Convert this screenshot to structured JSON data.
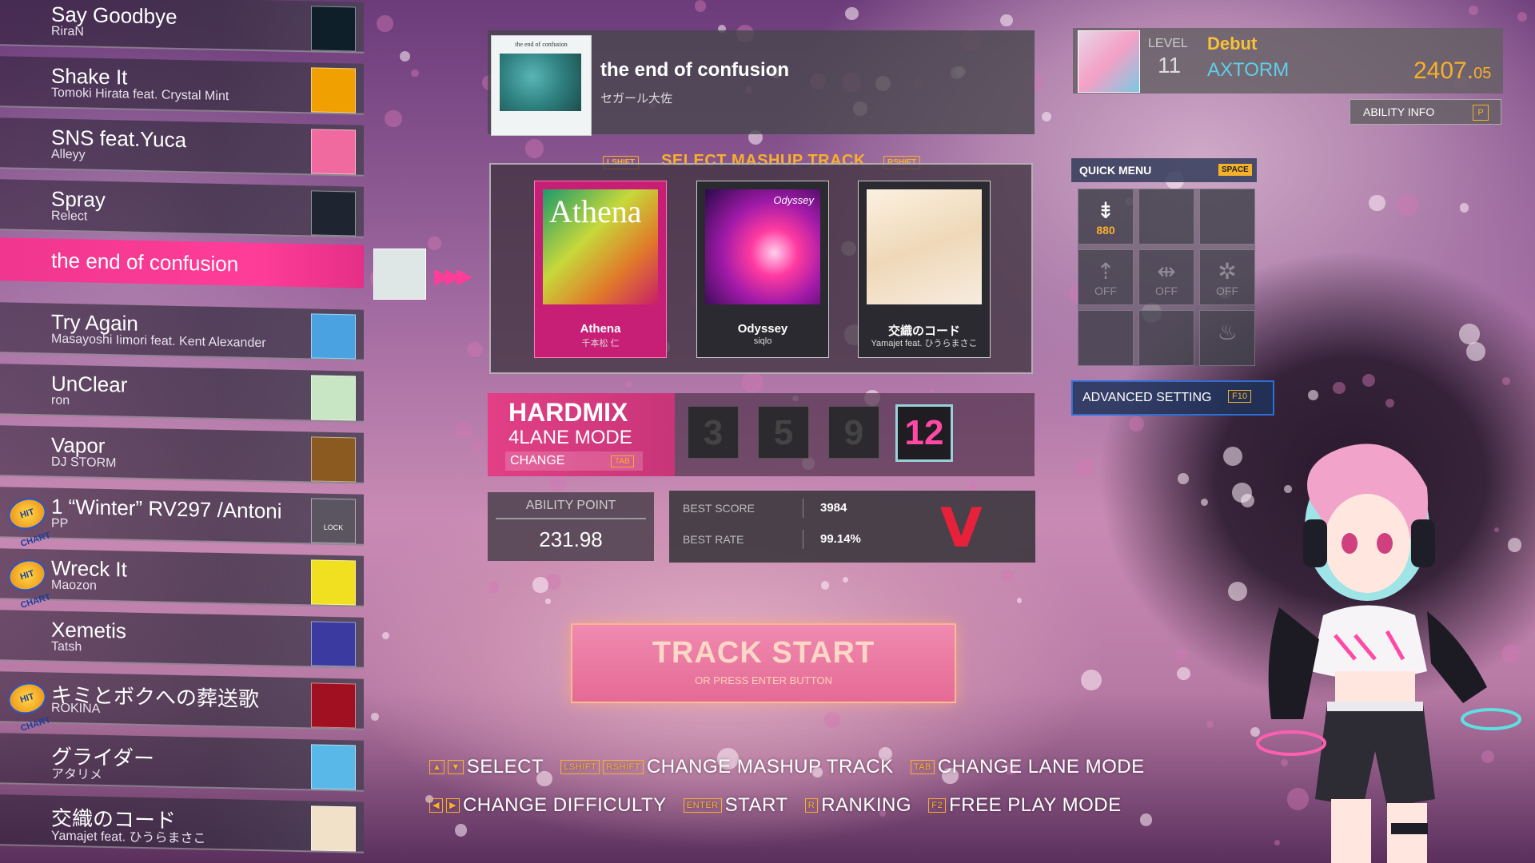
{
  "songs": [
    {
      "title": "Say Goodbye",
      "artist": "RiraN",
      "hit": false,
      "thumb_color": "#0f1f2a"
    },
    {
      "title": "Shake It",
      "artist": "Tomoki Hirata feat. Crystal Mint",
      "hit": false,
      "thumb_color": "#f0a000"
    },
    {
      "title": "SNS feat.Yuca",
      "artist": "Alleyy",
      "hit": false,
      "thumb_color": "#f06aa0"
    },
    {
      "title": "Spray",
      "artist": "Relect",
      "hit": false,
      "thumb_color": "#1e2530"
    },
    {
      "title": "the end of confusion",
      "artist": "",
      "hit": false,
      "thumb_color": ""
    },
    {
      "title": "Try Again",
      "artist": "Masayoshi Iimori feat. Kent Alexander",
      "hit": false,
      "thumb_color": "#4aa3e0"
    },
    {
      "title": "UnClear",
      "artist": "ron",
      "hit": false,
      "thumb_color": "#c9e6c4"
    },
    {
      "title": "Vapor",
      "artist": "DJ STORM",
      "hit": false,
      "thumb_color": "#8a5a20"
    },
    {
      "title": "1 “Winter” RV297 /Antoni",
      "artist": "PP",
      "hit": true,
      "thumb_color": "#5a5560"
    },
    {
      "title": "Wreck It",
      "artist": "Maozon",
      "hit": true,
      "thumb_color": "#f0e020"
    },
    {
      "title": "Xemetis",
      "artist": "Tatsh",
      "hit": false,
      "thumb_color": "#3a3aa0"
    },
    {
      "title": "キミとボクへの葬送歌",
      "artist": "ROKINA",
      "hit": true,
      "thumb_color": "#a01020"
    },
    {
      "title": "グライダー",
      "artist": "アタリメ",
      "hit": false,
      "thumb_color": "#5ab8e8"
    },
    {
      "title": "交織のコード",
      "artist": "Yamajet feat. ひうらまさこ",
      "hit": false,
      "thumb_color": "#f1e1c8"
    }
  ],
  "hit_badge": "HIT CHART",
  "lock_text": "LOCK",
  "now_playing": {
    "title": "the end of confusion",
    "artist": "セガール大佐",
    "cover_caption": "the end of confusion"
  },
  "mashup": {
    "header": "SELECT MASHUP TRACK",
    "left_key": "LSHIFT",
    "right_key": "RSHIFT",
    "tracks": [
      {
        "title": "Athena",
        "artist": "千本松 仁",
        "art_text": "Athena"
      },
      {
        "title": "Odyssey",
        "artist": "siqlo",
        "art_text": "Odyssey"
      },
      {
        "title": "交織のコード",
        "artist": "Yamajet feat. ひうらまさこ",
        "art_text": ""
      }
    ]
  },
  "mode": {
    "title": "HARDMIX",
    "subtitle": "4LANE MODE",
    "change_label": "CHANGE",
    "change_key": "TAB"
  },
  "difficulties": [
    "3",
    "5",
    "9",
    "12"
  ],
  "ability": {
    "label": "ABILITY POINT",
    "value": "231.98"
  },
  "best": {
    "score_label": "BEST SCORE",
    "score": "3984",
    "rate_label": "BEST RATE",
    "rate": "99.14%",
    "rank": "V"
  },
  "track_start": {
    "label": "TRACK START",
    "sub": "OR PRESS ENTER BUTTON"
  },
  "hints": {
    "select": "SELECT",
    "change_mashup": "CHANGE MASHUP TRACK",
    "change_lane": "CHANGE LANE MODE",
    "change_difficulty": "CHANGE DIFFICULTY",
    "start": "START",
    "ranking": "RANKING",
    "free_play": "FREE PLAY MODE",
    "keys": {
      "lshift": "LSHIFT",
      "rshift": "RSHIFT",
      "tab": "TAB",
      "enter": "ENTER",
      "r": "R",
      "f2": "F2"
    }
  },
  "player": {
    "level_label": "LEVEL",
    "level": "11",
    "title": "Debut",
    "name": "AXTORM",
    "points_main": "2407.",
    "points_frac": "05"
  },
  "ability_info": {
    "label": "ABILITY INFO",
    "key": "P"
  },
  "quick_menu": {
    "header": "QUICK MENU",
    "key": "SPACE",
    "cells": [
      {
        "icon": "⇟",
        "label": "880",
        "on": true
      },
      {
        "icon": "",
        "label": "",
        "on": false
      },
      {
        "icon": "",
        "label": "",
        "on": false
      },
      {
        "icon": "⇡",
        "label": "OFF",
        "on": false
      },
      {
        "icon": "⇹",
        "label": "OFF",
        "on": false
      },
      {
        "icon": "✲",
        "label": "OFF",
        "on": false
      },
      {
        "icon": "",
        "label": "",
        "on": false
      },
      {
        "icon": "",
        "label": "",
        "on": false
      },
      {
        "icon": "♨",
        "label": "",
        "on": false
      }
    ]
  },
  "advanced": {
    "label": "ADVANCED SETTING",
    "key": "F10"
  }
}
